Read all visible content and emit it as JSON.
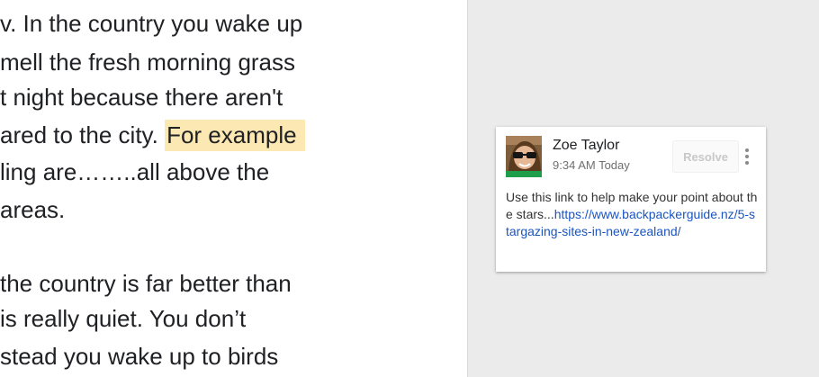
{
  "document": {
    "lines": [
      "v. In the country you wake up",
      "mell the fresh morning grass",
      "t night because there aren't",
      "ared to the city.",
      "ling are……..all above the",
      "areas.",
      "",
      "the country is far better than",
      "is really quiet. You don’t",
      "stead you wake up to birds"
    ],
    "highlighted_text": "For example ",
    "highlight_color": "#fce8b2"
  },
  "comment": {
    "author": "Zoe Taylor",
    "timestamp": "9:34 AM Today",
    "resolve_label": "Resolve",
    "body_text": "Use this link to help make your point about the stars...",
    "link_text": "https://www.backpackerguide.nz/5-stargazing-sites-in-new-zealand/",
    "link_color": "#1a55c0",
    "avatar_icon": "user-avatar-photo",
    "more_icon": "vertical-ellipsis-icon"
  }
}
